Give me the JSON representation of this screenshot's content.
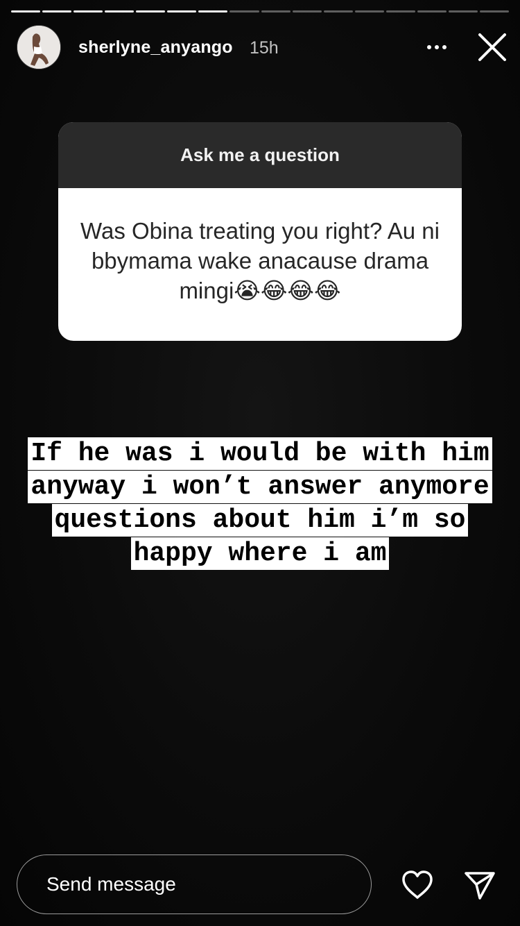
{
  "story": {
    "segments_total": 16,
    "segments_viewed": 7
  },
  "header": {
    "username": "sherlyne_anyango",
    "time_ago": "15h",
    "more_icon": "more-horizontal-icon",
    "close_icon": "close-icon"
  },
  "question_sticker": {
    "title": "Ask me a question",
    "question": "Was Obina treating you right? Au ni bbymama wake anacause drama mingi😭😂😂😂"
  },
  "answer": {
    "text": "If he was i would be with him anyway i won’t answer anymore questions about him i’m so happy where i am"
  },
  "footer": {
    "message_placeholder": "Send message",
    "like_icon": "heart-icon",
    "share_icon": "send-icon"
  },
  "colors": {
    "background": "#000000",
    "sticker_header": "#2a2a2a",
    "sticker_body": "#ffffff",
    "text_primary": "#ffffff"
  }
}
